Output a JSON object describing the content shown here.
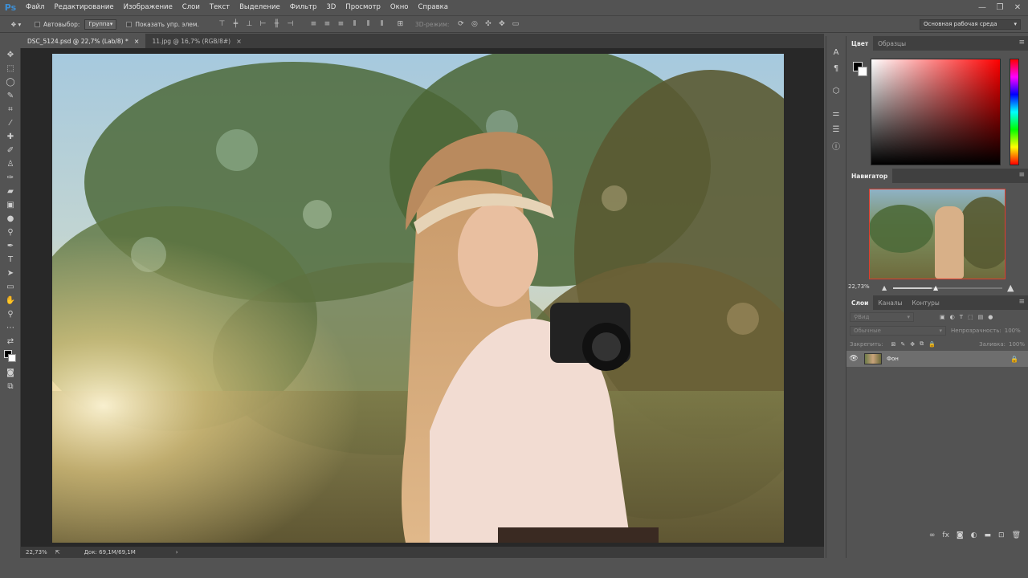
{
  "app": {
    "logo": "Ps"
  },
  "menu": [
    "Файл",
    "Редактирование",
    "Изображение",
    "Слои",
    "Текст",
    "Выделение",
    "Фильтр",
    "3D",
    "Просмотр",
    "Окно",
    "Справка"
  ],
  "window_controls": [
    "—",
    "❐",
    "✕"
  ],
  "options": {
    "autoselect_label": "Автовыбор:",
    "autoselect_value": "Группа",
    "show_transform_label": "Показать упр. элем.",
    "mode3d_label": "3D-режим:",
    "workspace": "Основная рабочая среда"
  },
  "tabs": [
    {
      "label": "DSC_5124.psd @ 22,7% (Lab/8) *",
      "close": "×"
    },
    {
      "label": "11.jpg @ 16,7% (RGB/8#)",
      "close": "×"
    }
  ],
  "status": {
    "zoom": "22,73%",
    "doc": "Док: 69,1M/69,1M"
  },
  "color_panel": {
    "tabs": [
      "Цвет",
      "Образцы"
    ]
  },
  "navigator": {
    "title": "Навигатор",
    "zoom": "22,73%",
    "progress": 0.35
  },
  "layers_panel": {
    "tabs": [
      "Слои",
      "Каналы",
      "Контуры"
    ],
    "filter_placeholder": "Вид",
    "blend_mode": "Обычные",
    "opacity_label": "Непрозрачность:",
    "opacity_value": "100%",
    "lock_label": "Закрепить:",
    "fill_label": "Заливка:",
    "fill_value": "100%",
    "layer_name": "Фон"
  },
  "colors": {
    "panel": "#535353",
    "canvas_bg": "#282828",
    "accent": "#3e8fd4",
    "nav_frame": "#e03c2c"
  }
}
